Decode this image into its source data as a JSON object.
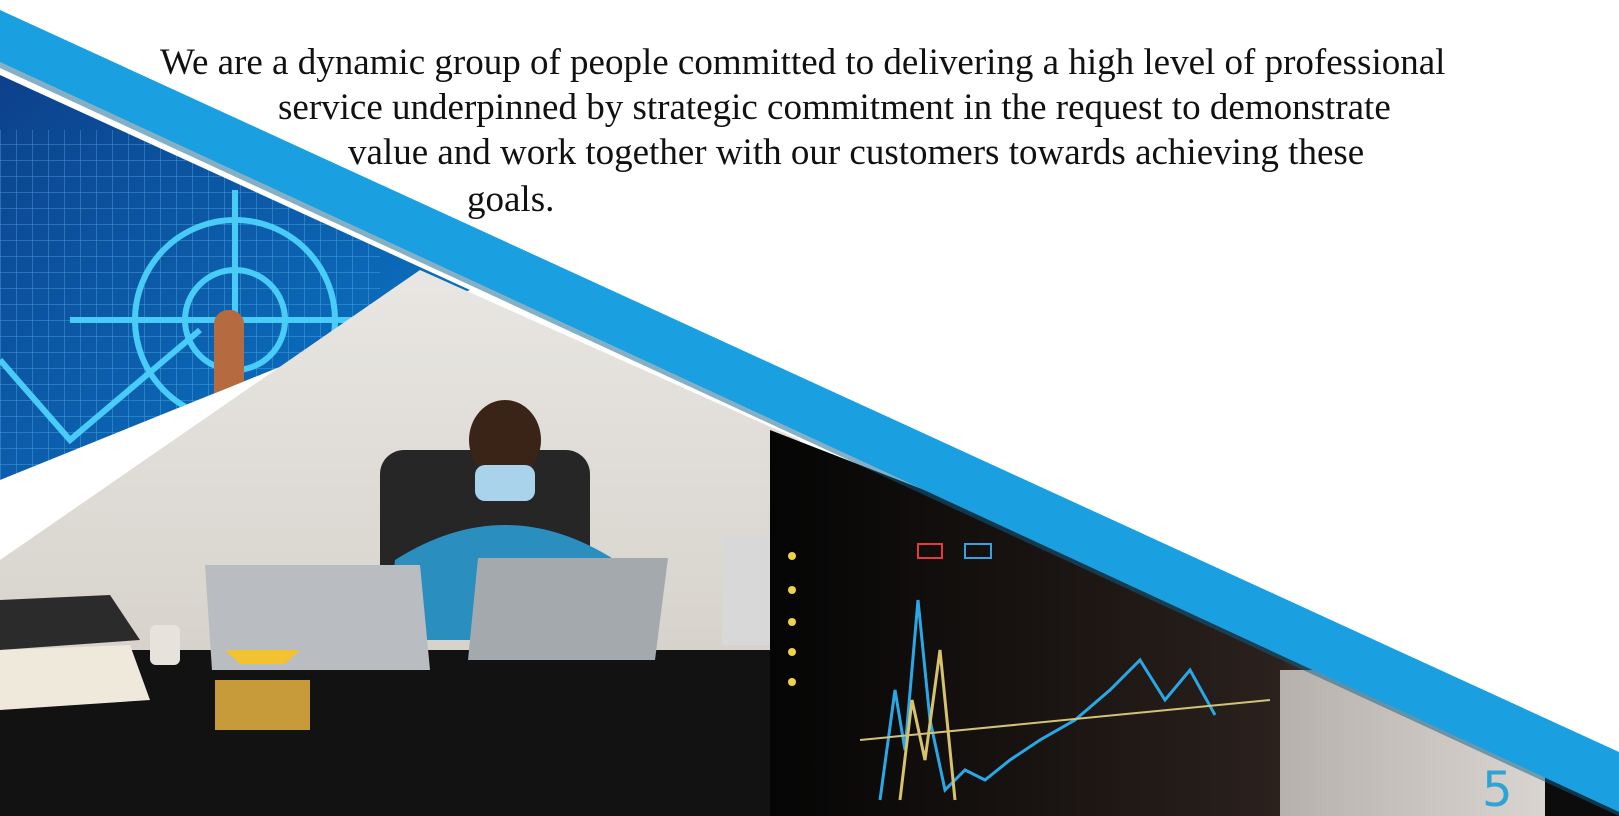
{
  "paragraph": {
    "lines": [
      "We are a dynamic group of people committed to delivering a high level of professional",
      "service underpinned by strategic commitment in the request to demonstrate",
      "value and work together with our customers towards achieving these",
      "goals."
    ]
  },
  "page_number": "5",
  "colors": {
    "accent_band": "#1aa0e0",
    "page_number": "#2fa3d6",
    "text": "#111111"
  },
  "images": [
    {
      "name": "target-grid-photo",
      "icon": "target-crosshair-icon"
    },
    {
      "name": "office-desk-photo"
    },
    {
      "name": "trading-chart-photo"
    }
  ]
}
